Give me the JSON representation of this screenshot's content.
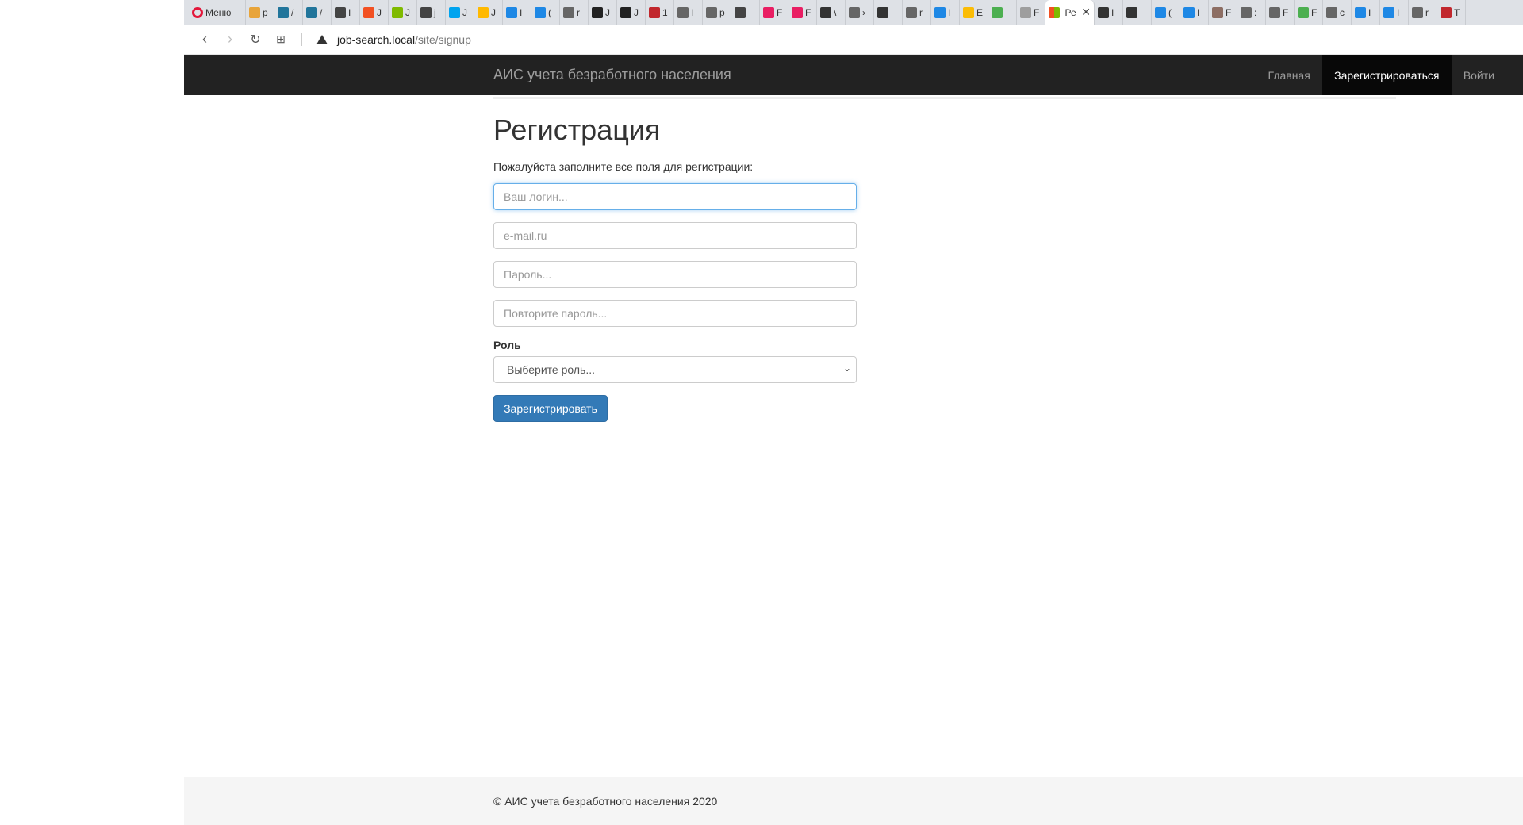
{
  "browser": {
    "menu_label": "Меню",
    "tabs": [
      {
        "label": "р",
        "color": "#e8a43a"
      },
      {
        "label": "/",
        "color": "#21759b"
      },
      {
        "label": "/",
        "color": "#21759b"
      },
      {
        "label": "I",
        "color": "#444444"
      },
      {
        "label": "J",
        "color": "#f25022"
      },
      {
        "label": "J",
        "color": "#7fba00"
      },
      {
        "label": "j",
        "color": "#444444"
      },
      {
        "label": "J",
        "color": "#00a4ef"
      },
      {
        "label": "J",
        "color": "#ffb900"
      },
      {
        "label": "I",
        "color": "#1e88e5"
      },
      {
        "label": "(",
        "color": "#1e88e5"
      },
      {
        "label": "r",
        "color": "#666666"
      },
      {
        "label": "J",
        "color": "#222222"
      },
      {
        "label": "J",
        "color": "#222222"
      },
      {
        "label": "1",
        "color": "#c1272d"
      },
      {
        "label": "I",
        "color": "#666666"
      },
      {
        "label": "p",
        "color": "#666666"
      },
      {
        "label": "",
        "color": "#444444"
      },
      {
        "label": "F",
        "color": "#e91e63"
      },
      {
        "label": "F",
        "color": "#e91e63"
      },
      {
        "label": "\\",
        "color": "#333333"
      },
      {
        "label": "›",
        "color": "#666666"
      },
      {
        "label": "",
        "color": "#333333"
      },
      {
        "label": "r",
        "color": "#666666"
      },
      {
        "label": "I",
        "color": "#1e88e5"
      },
      {
        "label": "E",
        "color": "#fbbc05"
      },
      {
        "label": "",
        "color": "#4caf50"
      },
      {
        "label": "F",
        "color": "#9e9e9e"
      }
    ],
    "active_tab_label": "Ре",
    "tabs_right": [
      {
        "label": "I",
        "color": "#333333"
      },
      {
        "label": "",
        "color": "#333333"
      },
      {
        "label": "(",
        "color": "#1e88e5"
      },
      {
        "label": "I",
        "color": "#1e88e5"
      },
      {
        "label": "F",
        "color": "#8d6e63"
      },
      {
        "label": ":",
        "color": "#666666"
      },
      {
        "label": "F",
        "color": "#666666"
      },
      {
        "label": "F",
        "color": "#4caf50"
      },
      {
        "label": "c",
        "color": "#666666"
      },
      {
        "label": "I",
        "color": "#1e88e5"
      },
      {
        "label": "I",
        "color": "#1e88e5"
      },
      {
        "label": "r",
        "color": "#666666"
      },
      {
        "label": "T",
        "color": "#c1272d"
      }
    ],
    "url_host": "job-search.local",
    "url_path": "/site/signup"
  },
  "navbar": {
    "brand": "АИС учета безработного населения",
    "links": {
      "home": "Главная",
      "register": "Зарегистрироваться",
      "login": "Войти"
    }
  },
  "form": {
    "title": "Регистрация",
    "intro": "Пожалуйста заполните все поля для регистрации:",
    "login_placeholder": "Ваш логин...",
    "email_placeholder": "e-mail.ru",
    "password_placeholder": "Пароль...",
    "password_repeat_placeholder": "Повторите пароль...",
    "role_label": "Роль",
    "role_selected": "Выберите роль...",
    "submit_label": "Зарегистрировать"
  },
  "footer": {
    "text": "© АИС учета безработного населения 2020"
  }
}
